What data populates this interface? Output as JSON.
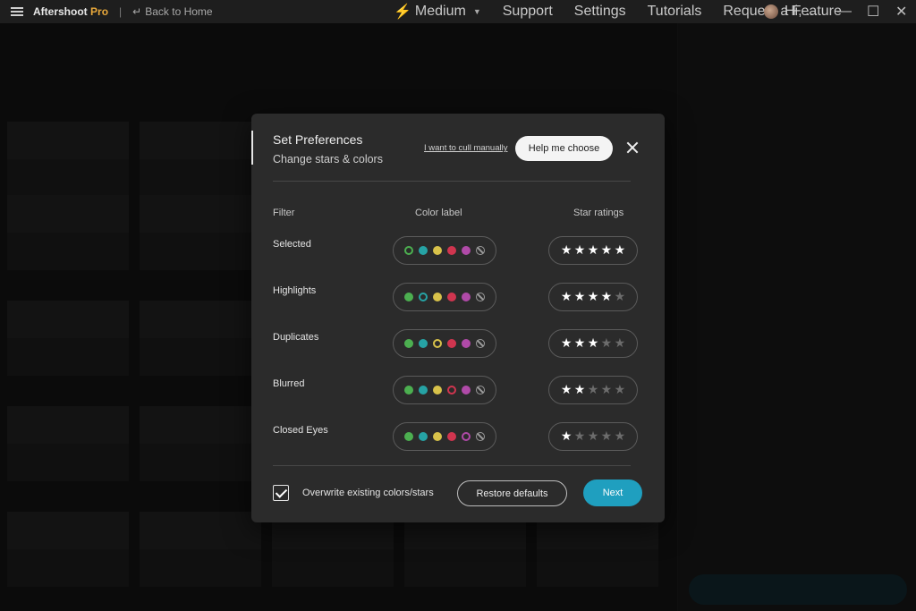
{
  "app": {
    "name": "Aftershoot",
    "edition": "Pro",
    "back_link": "Back to Home"
  },
  "menu": {
    "profile": "Medium",
    "items": [
      "Support",
      "Settings",
      "Tutorials",
      "Request a Feature"
    ],
    "user_greeting": "Hi, ..."
  },
  "modal": {
    "title": "Set Preferences",
    "subtitle": "Change stars & colors",
    "cull_link": "I want to cull manually",
    "help_button": "Help me choose",
    "headers": {
      "filter": "Filter",
      "color": "Color label",
      "stars": "Star ratings"
    },
    "rows": [
      {
        "label": "Selected",
        "selected_color_index": 0,
        "stars": 5
      },
      {
        "label": "Highlights",
        "selected_color_index": 1,
        "stars": 4
      },
      {
        "label": "Duplicates",
        "selected_color_index": 2,
        "stars": 3
      },
      {
        "label": "Blurred",
        "selected_color_index": 3,
        "stars": 2
      },
      {
        "label": "Closed Eyes",
        "selected_color_index": 4,
        "stars": 1
      }
    ],
    "color_labels": [
      {
        "name": "green",
        "hex": "#4caf50"
      },
      {
        "name": "teal",
        "hex": "#26a3a5"
      },
      {
        "name": "yellow",
        "hex": "#d8c24a"
      },
      {
        "name": "red",
        "hex": "#d0354f"
      },
      {
        "name": "purple",
        "hex": "#b04aa8"
      }
    ],
    "overwrite_label": "Overwrite existing colors/stars",
    "overwrite_checked": true,
    "restore_button": "Restore defaults",
    "next_button": "Next"
  }
}
